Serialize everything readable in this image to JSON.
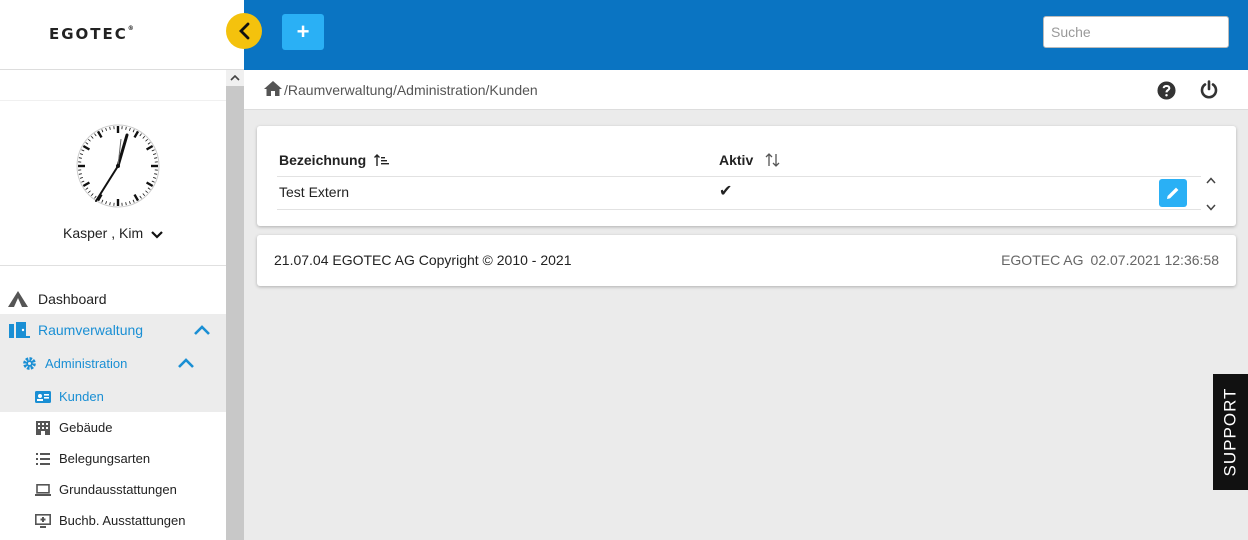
{
  "brand": {
    "logo_text": "EGOTEC",
    "registered": "®"
  },
  "user": {
    "name": "Kasper , Kim"
  },
  "sidebar": {
    "items": [
      {
        "label": "Dashboard",
        "icon": "tent-icon"
      },
      {
        "label": "Raumverwaltung",
        "icon": "door-icon",
        "expanded": true
      },
      {
        "label": "Administration",
        "icon": "gear-icon",
        "expanded": true
      },
      {
        "label": "Kunden",
        "icon": "id-card-icon",
        "selected": true
      },
      {
        "label": "Gebäude",
        "icon": "building-icon"
      },
      {
        "label": "Belegungsarten",
        "icon": "list-icon"
      },
      {
        "label": "Grundausstattungen",
        "icon": "laptop-icon"
      },
      {
        "label": "Buchb. Ausstattungen",
        "icon": "monitor-plus-icon"
      }
    ]
  },
  "topbar": {
    "add_label": "+",
    "search_placeholder": "Suche"
  },
  "breadcrumb": {
    "path": "/Raumverwaltung/Administration/Kunden"
  },
  "table": {
    "columns": [
      "Bezeichnung",
      "Aktiv"
    ],
    "rows": [
      {
        "bezeichnung": "Test Extern",
        "aktiv": "✔"
      }
    ]
  },
  "footer": {
    "left": "21.07.04 EGOTEC AG Copyright © 2010 - 2021",
    "company": "EGOTEC AG",
    "timestamp": "02.07.2021 12:36:58"
  },
  "support": {
    "label": "SUPPORT"
  },
  "colors": {
    "topbar": "#0a74c2",
    "accent": "#2ab0f5",
    "active_text": "#1a8fd4",
    "collapse": "#f4c20d"
  }
}
